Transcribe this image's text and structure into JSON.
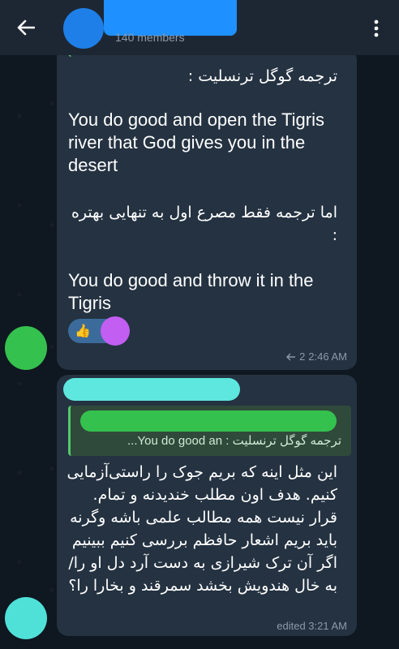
{
  "header": {
    "subtitle": "140 members",
    "colors": {
      "header_bg": "#1d2733",
      "avatar": "#1f7fe8",
      "title_redaction": "#1f90ff"
    }
  },
  "message1": {
    "label_fa": "ترجمه گوگل ترنسلیت :",
    "translation_google": "You do good and open the Tigris river that God gives you in the desert",
    "label_fa_2": "اما ترجمه فقط مصرع اول به تنهایی بهتره :",
    "translation_better": "You do good and throw it in the Tigris",
    "reaction_emoji": "👍",
    "reply_count": "2",
    "time": "2:46 AM"
  },
  "message2": {
    "reply_preview": "ترجمه گوگل ترنسلیت :  You do good an...",
    "body_fa": "این مثل اینه که بریم جوک را راستی‌آزمایی کنیم. هدف اون مطلب خندیدنه و تمام. قرار نیست همه مطالب علمی باشه وگرنه باید بریم اشعار حافظم بررسی کنیم ببینیم اگر آن ترک شیرازی به دست آرد دل او را/ به خال هندویش بخشد سمرقند و بخارا را؟",
    "time": "edited 3:21 AM"
  },
  "icons": {
    "back": "arrow-left-icon",
    "menu": "more-vertical-icon",
    "reply": "reply-icon"
  }
}
